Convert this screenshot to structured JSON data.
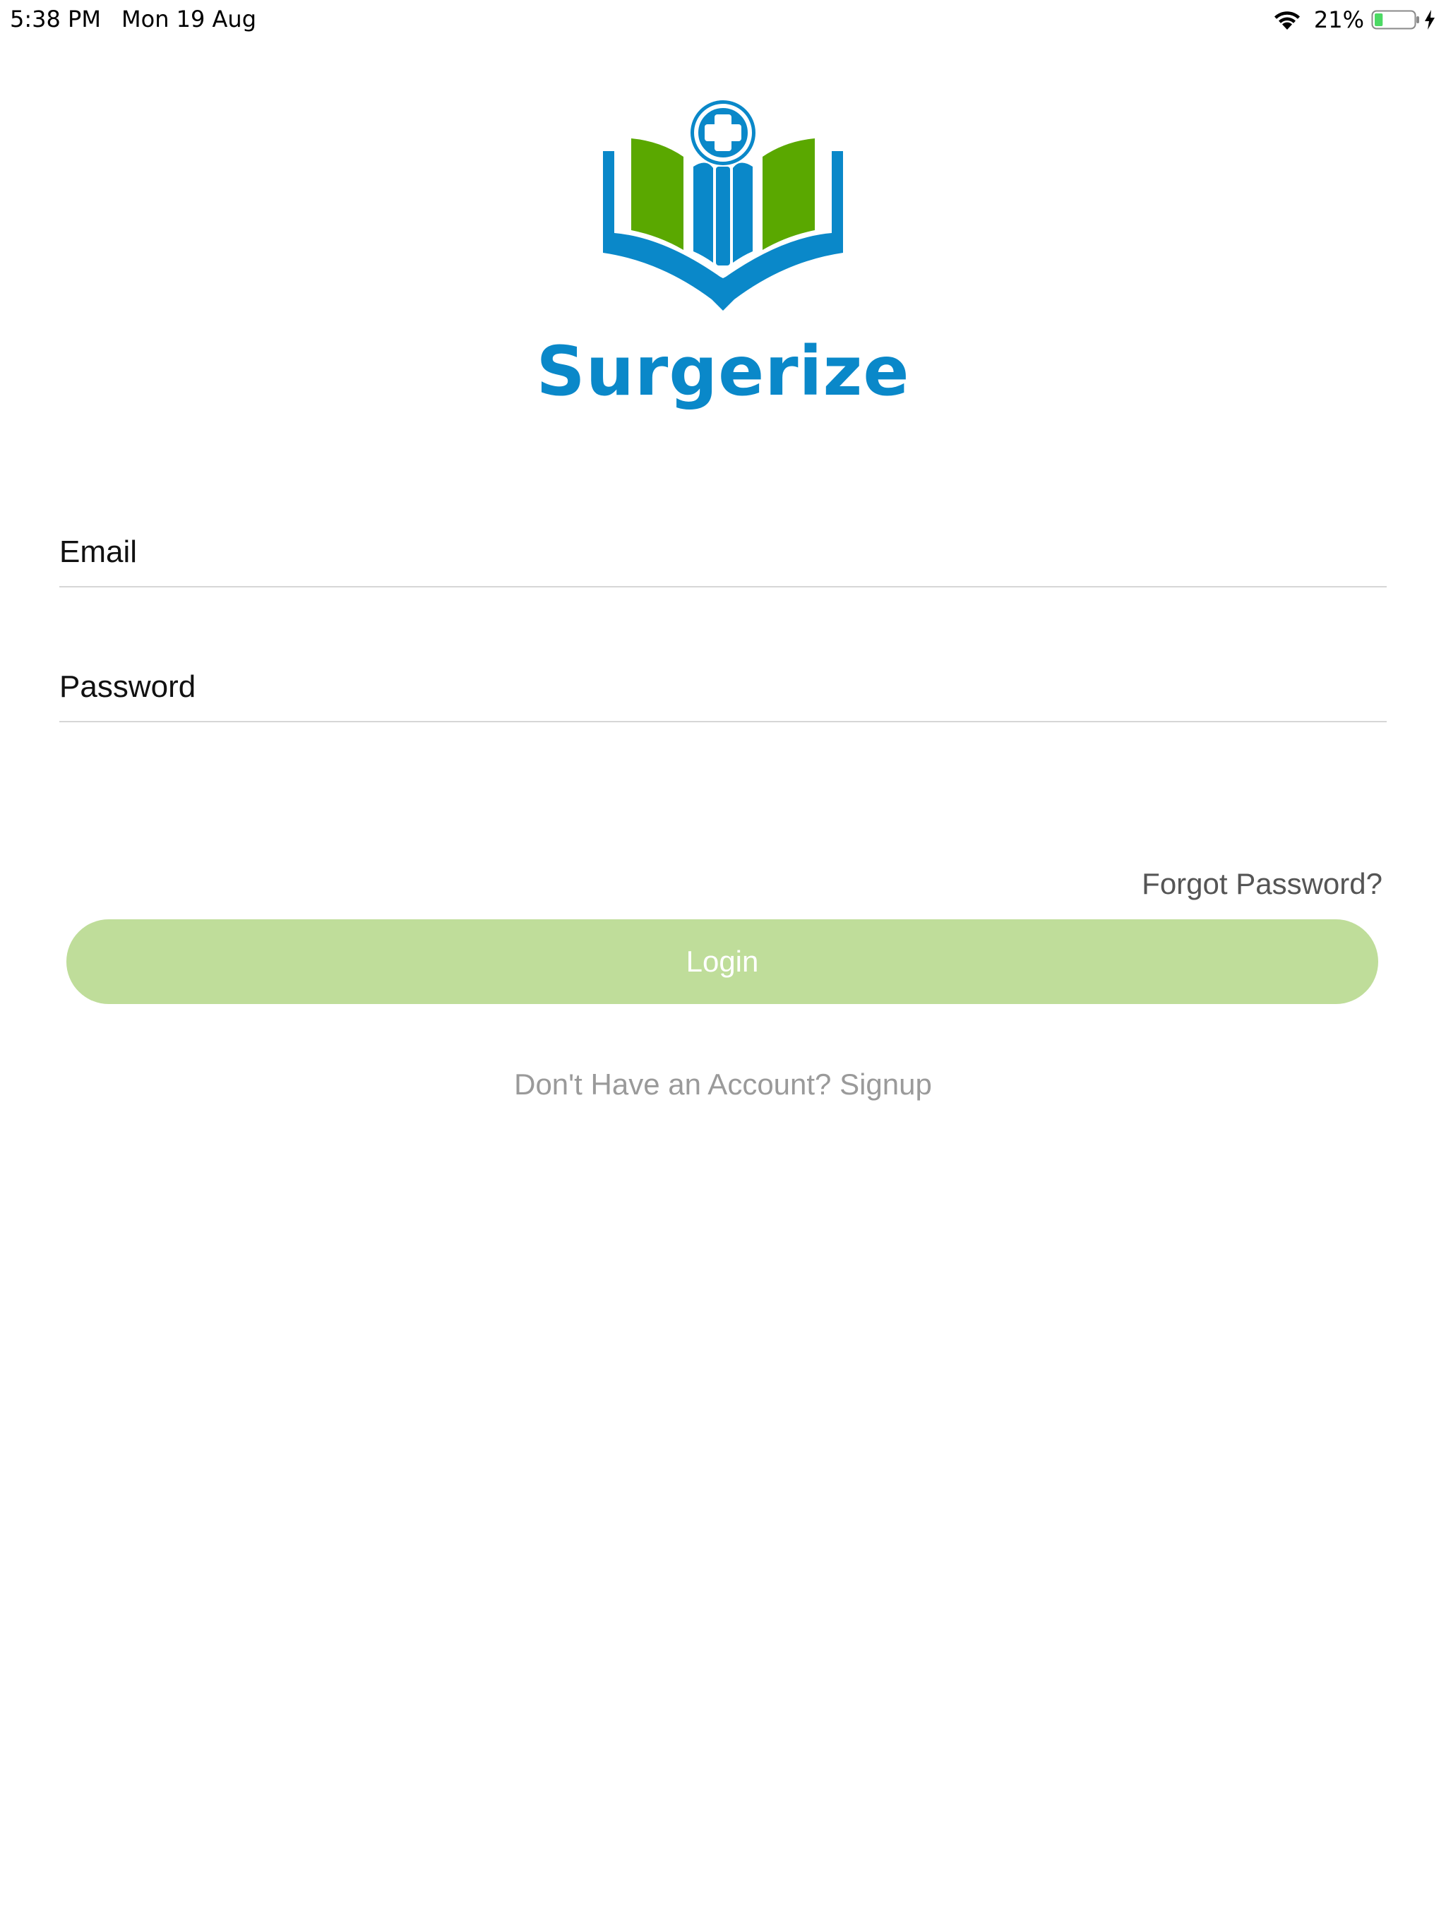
{
  "status_bar": {
    "time": "5:38 PM",
    "date": "Mon 19 Aug",
    "battery_percent": "21%",
    "battery_level": 0.21,
    "icons": [
      "wifi-icon",
      "battery-icon",
      "charging-icon"
    ]
  },
  "brand": {
    "name": "Surgerize",
    "logo_icon": "open-book-medical-cross-icon",
    "colors": {
      "primary_blue": "#0a88c9",
      "accent_green": "#5aa800"
    }
  },
  "form": {
    "email": {
      "placeholder": "Email",
      "value": ""
    },
    "password": {
      "placeholder": "Password",
      "value": ""
    },
    "forgot_password_label": "Forgot Password?",
    "login_label": "Login",
    "login_button_color": "#bfdd9a",
    "signup_prompt": "Don't Have an Account? Signup"
  }
}
